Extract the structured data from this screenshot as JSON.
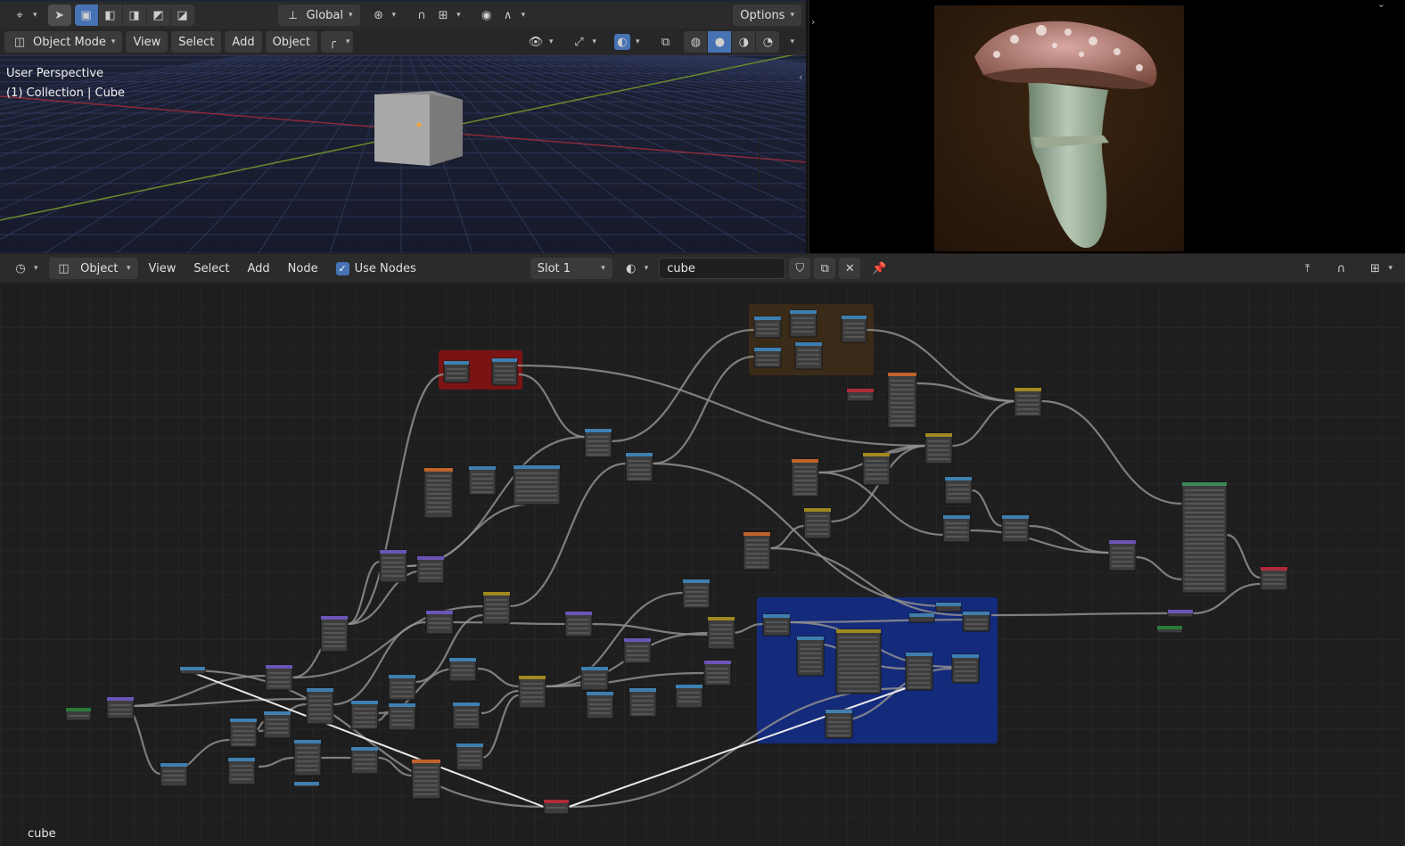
{
  "viewport": {
    "transform_orientation": "Global",
    "options_label": "Options",
    "mode_label": "Object Mode",
    "menus": [
      "View",
      "Select",
      "Add",
      "Object"
    ],
    "info_line1": "User Perspective",
    "info_line2": "(1) Collection | Cube"
  },
  "node_editor": {
    "editor_type": "Object",
    "menus": [
      "View",
      "Select",
      "Add",
      "Node"
    ],
    "use_nodes_label": "Use Nodes",
    "use_nodes_checked": true,
    "slot_label": "Slot 1",
    "material_name": "cube",
    "tree_label": "cube"
  },
  "colors": {
    "accent": "#4772b3",
    "frame_red": "#7a1414",
    "frame_brown": "#3a2a18",
    "frame_blue": "#142a7a"
  }
}
